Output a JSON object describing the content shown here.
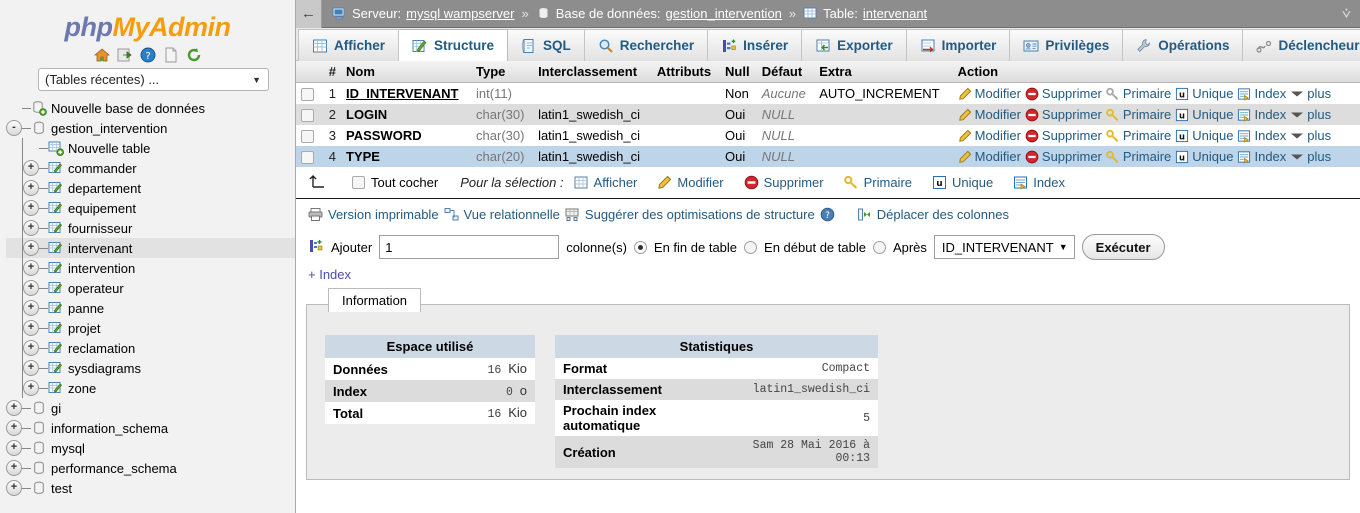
{
  "brand": {
    "php": "php",
    "my": "My",
    "admin": "Admin"
  },
  "sidebar": {
    "quick_icons": [
      {
        "name": "home-icon",
        "glyph": "⌂"
      },
      {
        "name": "logout-icon",
        "glyph": "➡"
      },
      {
        "name": "help-icon",
        "glyph": "?"
      },
      {
        "name": "docs-icon",
        "glyph": "❐"
      },
      {
        "name": "reload-icon",
        "glyph": "↻"
      }
    ],
    "recent_select": "(Tables récentes) ...",
    "tree": [
      {
        "label": "Nouvelle base de données",
        "level": 1,
        "toggle": "",
        "icon": "db-new-icon"
      },
      {
        "label": "gestion_intervention",
        "level": 1,
        "toggle": "-",
        "icon": "db-icon"
      },
      {
        "label": "Nouvelle table",
        "level": 2,
        "toggle": "",
        "icon": "table-new-icon"
      },
      {
        "label": "commander",
        "level": 2,
        "toggle": "+",
        "icon": "table-icon"
      },
      {
        "label": "departement",
        "level": 2,
        "toggle": "+",
        "icon": "table-icon"
      },
      {
        "label": "equipement",
        "level": 2,
        "toggle": "+",
        "icon": "table-icon"
      },
      {
        "label": "fournisseur",
        "level": 2,
        "toggle": "+",
        "icon": "table-icon"
      },
      {
        "label": "intervenant",
        "level": 2,
        "toggle": "+",
        "icon": "table-icon",
        "selected": true
      },
      {
        "label": "intervention",
        "level": 2,
        "toggle": "+",
        "icon": "table-icon"
      },
      {
        "label": "operateur",
        "level": 2,
        "toggle": "+",
        "icon": "table-icon"
      },
      {
        "label": "panne",
        "level": 2,
        "toggle": "+",
        "icon": "table-icon"
      },
      {
        "label": "projet",
        "level": 2,
        "toggle": "+",
        "icon": "table-icon"
      },
      {
        "label": "reclamation",
        "level": 2,
        "toggle": "+",
        "icon": "table-icon"
      },
      {
        "label": "sysdiagrams",
        "level": 2,
        "toggle": "+",
        "icon": "table-icon"
      },
      {
        "label": "zone",
        "level": 2,
        "toggle": "+",
        "icon": "table-icon"
      },
      {
        "label": "gi",
        "level": 1,
        "toggle": "+",
        "icon": "db-icon"
      },
      {
        "label": "information_schema",
        "level": 1,
        "toggle": "+",
        "icon": "db-icon"
      },
      {
        "label": "mysql",
        "level": 1,
        "toggle": "+",
        "icon": "db-icon"
      },
      {
        "label": "performance_schema",
        "level": 1,
        "toggle": "+",
        "icon": "db-icon"
      },
      {
        "label": "test",
        "level": 1,
        "toggle": "+",
        "icon": "db-icon"
      }
    ]
  },
  "topbar": {
    "back": "←",
    "server_label": "Serveur:",
    "server_value": "mysql wampserver",
    "db_label": "Base de données:",
    "db_value": "gestion_intervention",
    "table_label": "Table:",
    "table_value": "intervenant",
    "sep": "»",
    "collapse": "⩒"
  },
  "tabs": [
    {
      "label": "Afficher",
      "icon": "browse-icon",
      "active": false
    },
    {
      "label": "Structure",
      "icon": "structure-icon",
      "active": true
    },
    {
      "label": "SQL",
      "icon": "sql-icon",
      "active": false
    },
    {
      "label": "Rechercher",
      "icon": "search-icon",
      "active": false
    },
    {
      "label": "Insérer",
      "icon": "insert-icon",
      "active": false
    },
    {
      "label": "Exporter",
      "icon": "export-icon",
      "active": false
    },
    {
      "label": "Importer",
      "icon": "import-icon",
      "active": false
    },
    {
      "label": "Privilèges",
      "icon": "privileges-icon",
      "active": false
    },
    {
      "label": "Opérations",
      "icon": "operations-icon",
      "active": false
    },
    {
      "label": "Déclencheurs",
      "icon": "triggers-icon",
      "active": false
    }
  ],
  "columns_table": {
    "headers": [
      "",
      "#",
      "Nom",
      "Type",
      "Interclassement",
      "Attributs",
      "Null",
      "Défaut",
      "Extra",
      "Action"
    ],
    "rows": [
      {
        "num": "1",
        "name": "ID_INTERVENANT",
        "underline": true,
        "type": "int(11)",
        "collation": "",
        "attributes": "",
        "null": "Non",
        "default": "Aucune",
        "extra": "AUTO_INCREMENT",
        "rowstyle": "even",
        "primary_gray": true
      },
      {
        "num": "2",
        "name": "LOGIN",
        "underline": false,
        "type": "char(30)",
        "collation": "latin1_swedish_ci",
        "attributes": "",
        "null": "Oui",
        "default": "NULL",
        "extra": "",
        "rowstyle": "odd",
        "primary_gray": false
      },
      {
        "num": "3",
        "name": "PASSWORD",
        "underline": false,
        "type": "char(30)",
        "collation": "latin1_swedish_ci",
        "attributes": "",
        "null": "Oui",
        "default": "NULL",
        "extra": "",
        "rowstyle": "even",
        "primary_gray": false
      },
      {
        "num": "4",
        "name": "TYPE",
        "underline": false,
        "type": "char(20)",
        "collation": "latin1_swedish_ci",
        "attributes": "",
        "null": "Oui",
        "default": "NULL",
        "extra": "",
        "rowstyle": "hl",
        "primary_gray": false
      }
    ],
    "actions": [
      "Modifier",
      "Supprimer",
      "Primaire",
      "Unique",
      "Index",
      "plus"
    ]
  },
  "selection_bar": {
    "check_all": "Tout cocher",
    "for_selection": "Pour la sélection :",
    "actions": [
      "Afficher",
      "Modifier",
      "Supprimer",
      "Primaire",
      "Unique",
      "Index"
    ]
  },
  "links_bar": {
    "printable": "Version imprimable",
    "relational": "Vue relationnelle",
    "suggest": "Suggérer des optimisations de structure",
    "move_columns": "Déplacer des colonnes"
  },
  "add_form": {
    "label": "Ajouter",
    "count_value": "1",
    "columns_word": "colonne(s)",
    "opt_end": "En fin de table",
    "opt_begin": "En début de table",
    "opt_after": "Après",
    "after_column": "ID_INTERVENANT",
    "execute": "Exécuter",
    "index_link": "+ Index"
  },
  "info_panel": {
    "tab_label": "Information",
    "space": {
      "title": "Espace utilisé",
      "rows": [
        {
          "key": "Données",
          "value": "16",
          "unit": "Kio"
        },
        {
          "key": "Index",
          "value": "0",
          "unit": "o"
        },
        {
          "key": "Total",
          "value": "16",
          "unit": "Kio"
        }
      ]
    },
    "stats": {
      "title": "Statistiques",
      "rows": [
        {
          "key": "Format",
          "value": "Compact"
        },
        {
          "key": "Interclassement",
          "value": "latin1_swedish_ci"
        },
        {
          "key": "Prochain index automatique",
          "value": "5"
        },
        {
          "key": "Création",
          "value": "Sam 28 Mai 2016 à 00:13"
        }
      ]
    }
  },
  "colors": {
    "accent_link": "#235a81",
    "topbar_bg": "#8d8d8d",
    "row_highlight": "#bed4e8",
    "stat_header": "#ccd8e3",
    "brand_orange": "#F89C0E",
    "brand_blue": "#6C78AF"
  }
}
